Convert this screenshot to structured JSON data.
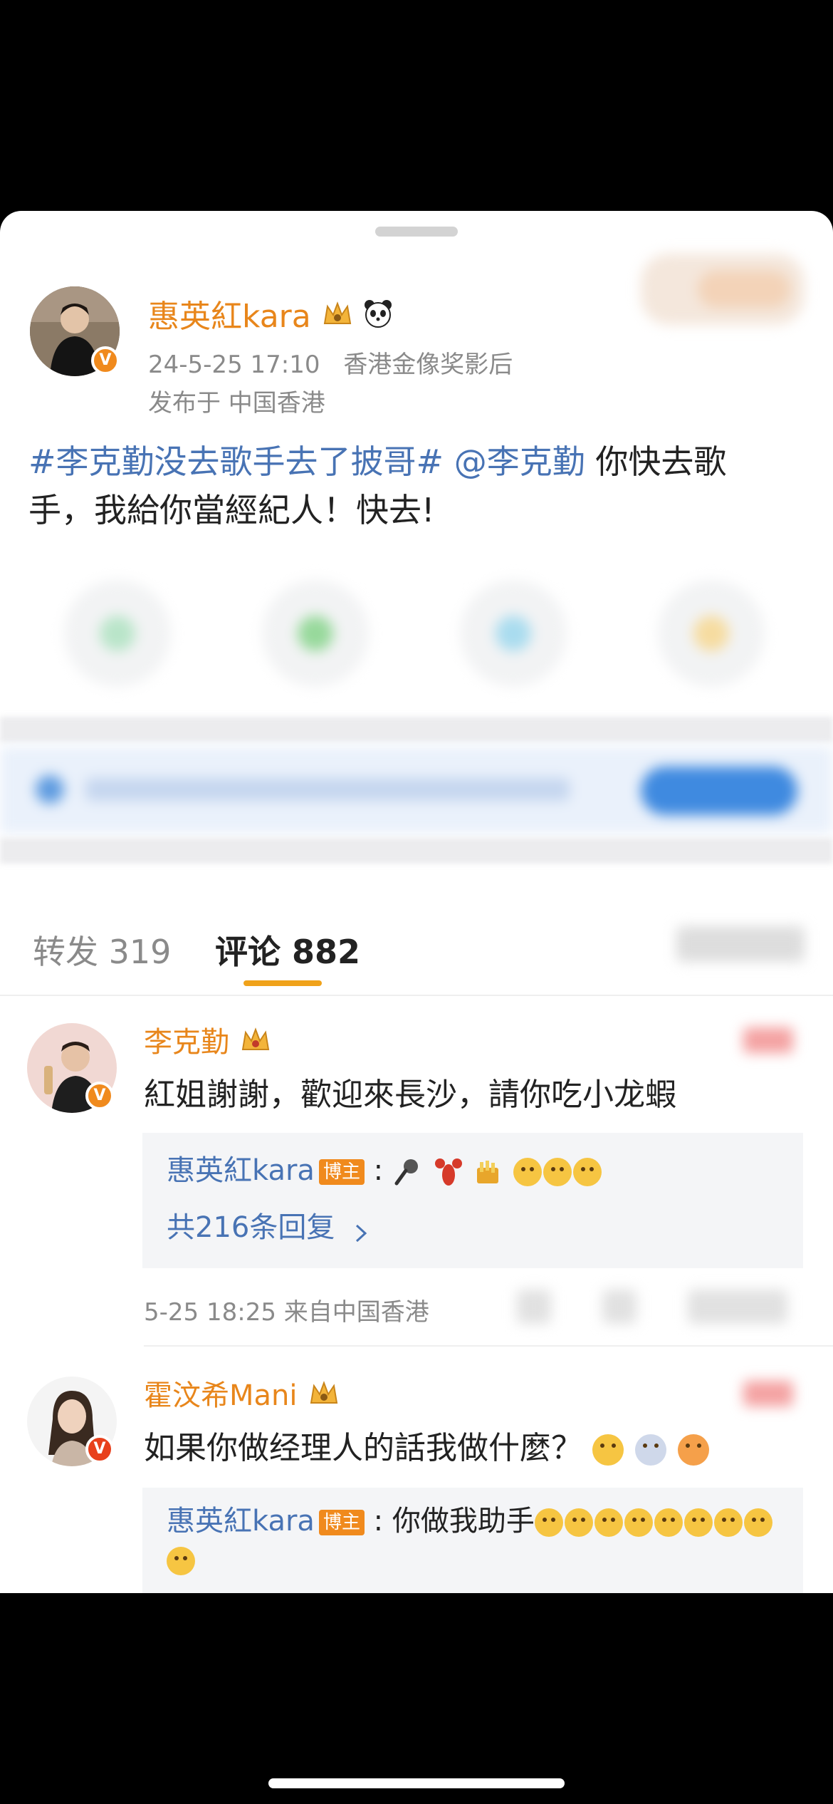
{
  "post": {
    "author": "惠英紅kara",
    "time_tag": "24-5-25 17:10",
    "title_tag": "香港金像奖影后",
    "location": "发布于 中国香港",
    "hashtag": "#李克勤没去歌手去了披哥#",
    "mention": "@李克勤",
    "text_line1": " 你快去歌",
    "text_line2": "手，我給你當經紀人！快去!"
  },
  "tabs": {
    "repost": "转发 319",
    "comment": "评论 882"
  },
  "comments": [
    {
      "author": "李克勤",
      "text": "紅姐謝謝，歡迎來長沙，請你吃小龙蝦",
      "reply_author": "惠英紅kara",
      "reply_badge": "博主",
      "reply_sep": ":",
      "reply_more": "共216条回复",
      "meta": "5-25 18:25 来自中国香港"
    },
    {
      "author": "霍汶希Mani",
      "text": "如果你做经理人的話我做什麼？",
      "reply_author": "惠英紅kara",
      "reply_badge": "博主",
      "reply_text": "你做我助手"
    }
  ],
  "badges": {
    "verified": "V"
  },
  "icons": [
    "crown-icon",
    "panda-icon",
    "microphone-icon",
    "lobster-icon",
    "fries-icon",
    "emoji-icon",
    "chevron-right-icon"
  ],
  "colors": {
    "name_orange": "#e8861b",
    "link_blue": "#4873b4",
    "badge_orange": "#f08a1d",
    "tab_underline": "#f0a21a"
  }
}
